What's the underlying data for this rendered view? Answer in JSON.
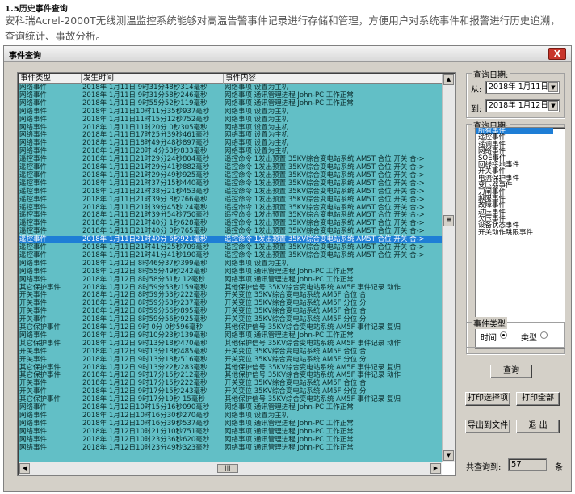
{
  "doc": {
    "heading": "1.5历史事件查询",
    "paragraph": "安科瑞Acrel-2000T无线测温监控系统能够对高温告警事件记录进行存储和管理，方便用户对系统事件和报警进行历史追溯，查询统计、事故分析。"
  },
  "window": {
    "title": "事件查询",
    "close_label": "X"
  },
  "grid": {
    "columns": [
      "事件类型",
      "发生时间",
      "事件内容"
    ],
    "rows": [
      {
        "type": "网络事件",
        "time": "2018年 1月11日  9时31分48秒314毫秒",
        "content": "网络事项  设置为主机"
      },
      {
        "type": "网络事件",
        "time": "2018年 1月11日  9时31分58秒246毫秒",
        "content": "网络事项 通讯管理进程 John-PC 工作正常"
      },
      {
        "type": "网络事件",
        "time": "2018年 1月11日  9时55分52秒119毫秒",
        "content": "网络事项 通讯管理进程 John-PC 工作正常"
      },
      {
        "type": "网络事件",
        "time": "2018年 1月11日10时11分35秒937毫秒",
        "content": "网络事项  设置为主机"
      },
      {
        "type": "网络事件",
        "time": "2018年 1月11日11时15分12秒752毫秒",
        "content": "网络事项  设置为主机"
      },
      {
        "type": "网络事件",
        "time": "2018年 1月11日11时20分  0秒305毫秒",
        "content": "网络事项  设置为主机"
      },
      {
        "type": "网络事件",
        "time": "2018年 1月11日17时25分39秒461毫秒",
        "content": "网络事项  设置为主机"
      },
      {
        "type": "网络事件",
        "time": "2018年 1月11日18时49分48秒897毫秒",
        "content": "网络事项  设置为主机"
      },
      {
        "type": "网络事件",
        "time": "2018年 1月11日20时  4分53秒833毫秒",
        "content": "网络事项  设置为主机"
      },
      {
        "type": "遥控事件",
        "time": "2018年 1月11日21时29分24秒804毫秒",
        "content": "遥控命令  1发出预置 35KV综合变电站系统 AM5T 合位 开关 合->"
      },
      {
        "type": "遥控事件",
        "time": "2018年 1月11日21时29分41秒882毫秒",
        "content": "遥控命令  1发出预置 35KV综合变电站系统 AM5T 合位 开关 合->"
      },
      {
        "type": "遥控事件",
        "time": "2018年 1月11日21时29分49秒925毫秒",
        "content": "遥控命令  1发出预置 35KV综合变电站系统 AM5T 合位 开关 合->"
      },
      {
        "type": "遥控事件",
        "time": "2018年 1月11日21时37分15秒440毫秒",
        "content": "遥控命令  1发出预置 35KV综合变电站系统 AM5T 合位 开关 合->"
      },
      {
        "type": "遥控事件",
        "time": "2018年 1月11日21时38分21秒453毫秒",
        "content": "遥控命令  1发出预置 35KV综合变电站系统 AM5T 合位 开关 合->"
      },
      {
        "type": "遥控事件",
        "time": "2018年 1月11日21时39分  8秒766毫秒",
        "content": "遥控命令  1发出预置 35KV综合变电站系统 AM5T 合位 开关 合->"
      },
      {
        "type": "遥控事件",
        "time": "2018年 1月11日21时39分45秒  24毫秒",
        "content": "遥控命令  1发出预置 35KV综合变电站系统 AM5T 合位 开关 合->"
      },
      {
        "type": "遥控事件",
        "time": "2018年 1月11日21时39分54秒750毫秒",
        "content": "遥控命令  1发出预置 35KV综合变电站系统 AM5T 合位 开关 合->"
      },
      {
        "type": "遥控事件",
        "time": "2018年 1月11日21时40分  1秒628毫秒",
        "content": "遥控命令  1发出预置 35KV综合变电站系统 AM5T 合位 开关 合->"
      },
      {
        "type": "遥控事件",
        "time": "2018年 1月11日21时40分  0秒765毫秒",
        "content": "遥控命令  1发出预置 35KV综合变电站系统 AM5T 合位 开关 合->"
      },
      {
        "type": "遥控事件",
        "time": "2018年 1月11日21时40分  6秒921毫秒",
        "content": "遥控命令  1发出预置 35KV综合变电站系统 AM5T 合位 开关 合->",
        "selected": true
      },
      {
        "type": "遥控事件",
        "time": "2018年 1月11日21时41分25秒709毫秒",
        "content": "遥控命令  1发出预置 35KV综合变电站系统 AM5T 合位 开关 合->"
      },
      {
        "type": "遥控事件",
        "time": "2018年 1月11日21时41分41秒190毫秒",
        "content": "遥控命令  1发出预置 35KV综合变电站系统 AM5T 合位 开关 合->"
      },
      {
        "type": "网络事件",
        "time": "2018年 1月12日  8时46分37秒399毫秒",
        "content": "网络事项  设置为主机"
      },
      {
        "type": "网络事件",
        "time": "2018年 1月12日  8时55分49秒242毫秒",
        "content": "网络事项 通讯管理进程 John-PC 工作正常"
      },
      {
        "type": "网络事件",
        "time": "2018年 1月12日  8时58分51秒  12毫秒",
        "content": "网络事项 通讯管理进程 John-PC 工作正常"
      },
      {
        "type": "其它保护事件",
        "time": "2018年 1月12日  8时59分53秒159毫秒",
        "content": "其他保护信号 35KV综合变电站系统 AM5F 事件记录  动作"
      },
      {
        "type": "开关事件",
        "time": "2018年 1月12日  8时59分53秒222毫秒",
        "content": "开关变位  35KV综合变电站系统 AM5F 合位  合"
      },
      {
        "type": "开关事件",
        "time": "2018年 1月12日  8时59分53秒237毫秒",
        "content": "开关变位  35KV综合变电站系统 AM5F 分位  分"
      },
      {
        "type": "开关事件",
        "time": "2018年 1月12日  8时59分56秒895毫秒",
        "content": "开关变位  35KV综合变电站系统 AM5F 合位  合"
      },
      {
        "type": "开关事件",
        "time": "2018年 1月12日  8时59分56秒925毫秒",
        "content": "开关变位  35KV综合变电站系统 AM5F 分位  分"
      },
      {
        "type": "其它保护事件",
        "time": "2018年 1月12日  9时  0分  0秒596毫秒",
        "content": "其他保护信号 35KV综合变电站系统 AM5F 事件记录  复归"
      },
      {
        "type": "网络事件",
        "time": "2018年 1月12日  9时10分23秒139毫秒",
        "content": "网络事项 通讯管理进程 John-PC 工作正常"
      },
      {
        "type": "其它保护事件",
        "time": "2018年 1月12日  9时13分18秒470毫秒",
        "content": "其他保护信号 35KV综合变电站系统 AM5F 事件记录  动作"
      },
      {
        "type": "开关事件",
        "time": "2018年 1月12日  9时13分18秒485毫秒",
        "content": "开关变位  35KV综合变电站系统 AM5F 合位  合"
      },
      {
        "type": "开关事件",
        "time": "2018年 1月12日  9时13分18秒516毫秒",
        "content": "开关变位  35KV综合变电站系统 AM5F 分位  分"
      },
      {
        "type": "其它保护事件",
        "time": "2018年 1月12日  9时13分22秒283毫秒",
        "content": "其他保护信号 35KV综合变电站系统 AM5F 事件记录  复归"
      },
      {
        "type": "其它保护事件",
        "time": "2018年 1月12日  9时17分15秒212毫秒",
        "content": "其他保护信号 35KV综合变电站系统 AM5F 事件记录  动作"
      },
      {
        "type": "开关事件",
        "time": "2018年 1月12日  9时17分15秒222毫秒",
        "content": "开关变位  35KV综合变电站系统 AM5F 合位  合"
      },
      {
        "type": "开关事件",
        "time": "2018年 1月12日  9时17分15秒243毫秒",
        "content": "开关变位  35KV综合变电站系统 AM5F 分位  分"
      },
      {
        "type": "其它保护事件",
        "time": "2018年 1月12日  9时17分19秒  15毫秒",
        "content": "其他保护信号 35KV综合变电站系统 AM5F 事件记录  复归"
      },
      {
        "type": "网络事件",
        "time": "2018年 1月12日10时15分16秒090毫秒",
        "content": "网络事项 通讯管理进程 John-PC 工作正常"
      },
      {
        "type": "网络事件",
        "time": "2018年 1月12日10时16分30秒270毫秒",
        "content": "网络事项  设置为主机"
      },
      {
        "type": "网络事件",
        "time": "2018年 1月12日10时16分39秒537毫秒",
        "content": "网络事项 通讯管理进程 John-PC 工作正常"
      },
      {
        "type": "网络事件",
        "time": "2018年 1月12日10时21分10秒751毫秒",
        "content": "网络事项 通讯管理进程 John-PC 工作正常"
      },
      {
        "type": "网络事件",
        "time": "2018年 1月12日10时23分36秒620毫秒",
        "content": "网络事项 通讯管理进程 John-PC 工作正常"
      },
      {
        "type": "网络事件",
        "time": "2018年 1月12日10时23分49秒323毫秒",
        "content": "网络事项 通讯管理进程 John-PC 工作正常"
      }
    ]
  },
  "query_date": {
    "title": "查询日期:",
    "from_label": "从:",
    "from_value": "2018年 1月11日",
    "to_label": "到:",
    "to_value": "2018年 1月12日"
  },
  "query_items": {
    "title": "查询日期:",
    "items": [
      "所有事件",
      "遥控事件",
      "遥调事件",
      "网络事件",
      "SOE事件",
      "回线接地事件",
      "开关事件",
      "电流保护事件",
      "变压器事件",
      "刀闸事件",
      "越限事件",
      "故障事件",
      "过压事件",
      "欠压事件",
      "设备状态事件",
      "开关动作跳限事件"
    ]
  },
  "sort": {
    "title": "事件类型",
    "time_label": "时间",
    "type_label": "类型"
  },
  "buttons": {
    "query": "查询",
    "print_selected": "打印选择项",
    "print_all": "打印全部",
    "export": "导出到文件",
    "exit": "退 出"
  },
  "count": {
    "label": "共查询到:",
    "value": "57",
    "unit": "条"
  },
  "colors": {
    "grid_bg": "#62bfc6",
    "selection": "#1e7ed6"
  }
}
